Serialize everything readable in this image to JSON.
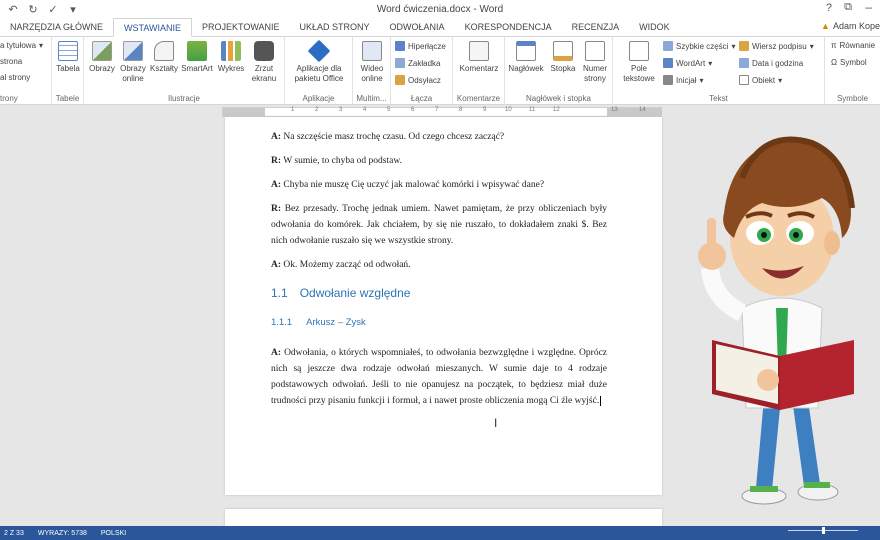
{
  "window": {
    "title": "Word ćwiczenia.docx - Word",
    "help": "?",
    "user_name": "Adam Kope"
  },
  "tabs": [
    {
      "label": "NARZĘDZIA GŁÓWNE"
    },
    {
      "label": "WSTAWIANIE",
      "active": true
    },
    {
      "label": "PROJEKTOWANIE"
    },
    {
      "label": "UKŁAD STRONY"
    },
    {
      "label": "ODWOŁANIA"
    },
    {
      "label": "KORESPONDENCJA"
    },
    {
      "label": "RECENZJA"
    },
    {
      "label": "WIDOK"
    }
  ],
  "ribbon": {
    "strony": {
      "items": [
        "a tytułowa",
        "strona",
        "al strony"
      ],
      "group": "trony"
    },
    "tabele": {
      "tabela": "Tabela",
      "group": "Tabele"
    },
    "ilustracje": {
      "obrazy": "Obrazy",
      "obrazy_online_1": "Obrazy",
      "obrazy_online_2": "online",
      "ksztalty": "Kształty",
      "smartart": "SmartArt",
      "wykres": "Wykres",
      "zrzut_1": "Zrzut",
      "zrzut_2": "ekranu",
      "group": "Ilustracje"
    },
    "aplikacje": {
      "l1": "Aplikacje dla",
      "l2": "pakietu Office",
      "group": "Aplikacje"
    },
    "multimedia": {
      "wideo_1": "Wideo",
      "wideo_2": "online",
      "group": "Multim..."
    },
    "lacza": {
      "hiperlacze": "Hiperłącze",
      "zakladka": "Zakładka",
      "odsylacz": "Odsyłacz",
      "group": "Łącza"
    },
    "komentarze": {
      "komentarz": "Komentarz",
      "group": "Komentarze"
    },
    "naglowek": {
      "naglowek": "Nagłówek",
      "stopka": "Stopka",
      "numer_1": "Numer",
      "numer_2": "strony",
      "group": "Nagłówek i stopka"
    },
    "tekst": {
      "pole_1": "Pole",
      "pole_2": "tekstowe",
      "szybkie": "Szybkie części",
      "wordart": "WordArt",
      "inicjal": "Inicjał",
      "wiersz": "Wiersz podpisu",
      "data": "Data i godzina",
      "obiekt": "Obiekt",
      "group": "Tekst"
    },
    "symbole": {
      "rownanie": "Równanie",
      "symbol": "Symbol",
      "group": "Symbole"
    }
  },
  "ruler": {
    "numbers": [
      "1",
      "2",
      "3",
      "4",
      "5",
      "6",
      "7",
      "8",
      "9",
      "10",
      "11",
      "12",
      "13",
      "14"
    ]
  },
  "document": {
    "p1": {
      "speaker": "A:",
      "text": "Na szczęście masz trochę czasu. Od czego chcesz zacząć?"
    },
    "p2": {
      "speaker": "R:",
      "text": "W sumie, to chyba od podstaw."
    },
    "p3": {
      "speaker": "A:",
      "text": "Chyba nie muszę Cię uczyć jak malować komórki i wpisywać dane?"
    },
    "p4": {
      "speaker": "R:",
      "text": "Bez przesady. Trochę jednak umiem. Nawet pamiętam, że przy obliczeniach były odwołania do komórek. Jak chciałem, by się nie ruszało, to dokładałem znaki $. Bez nich odwołanie ruszało się we wszystkie strony."
    },
    "p5": {
      "speaker": "A:",
      "text": "Ok. Możemy zacząć od odwołań."
    },
    "h1": {
      "num": "1.1",
      "text": "Odwołanie względne"
    },
    "h2": {
      "num": "1.1.1",
      "text": "Arkusz – Zysk"
    },
    "p6": {
      "speaker": "A:",
      "text": "Odwołania, o których wspomniałeś, to odwołania bezwzględne i względne. Oprócz nich są jeszcze dwa rodzaje odwołań mieszanych. W sumie daje to 4 rodzaje podstawowych odwołań. Jeśli to nie opanujesz na początek, to będziesz miał duże trudności przy pisaniu funkcji i formuł, a i nawet proste obliczenia mogą Ci źle wyjść."
    }
  },
  "status": {
    "page": "2 Z 33",
    "words": "WYRAZY: 5738",
    "language": "POLSKI"
  },
  "colors": {
    "accent": "#2b579a",
    "heading": "#2e74b5"
  }
}
